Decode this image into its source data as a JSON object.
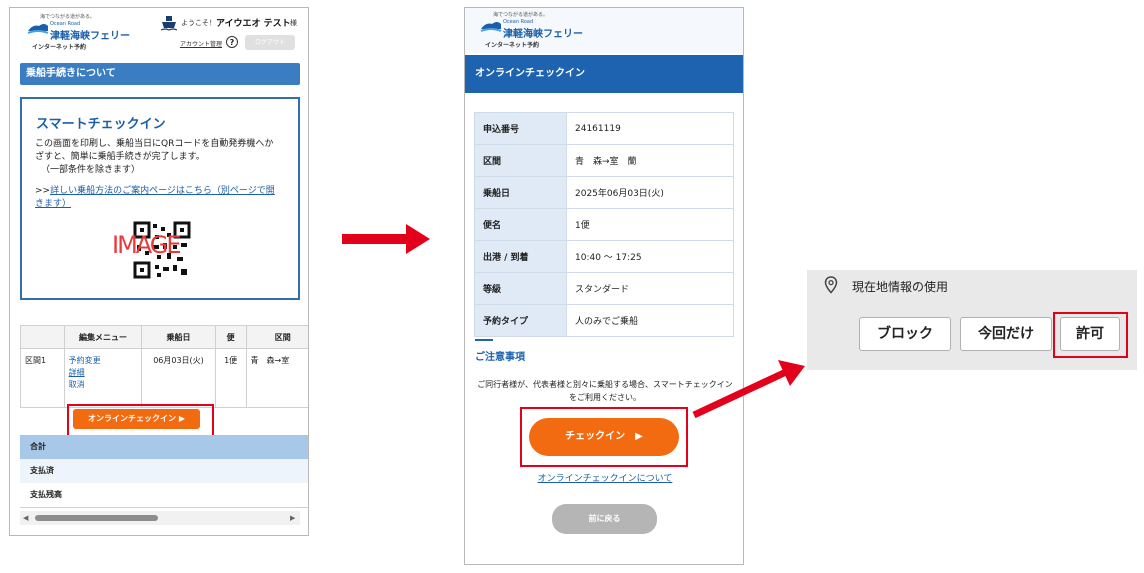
{
  "panel1": {
    "logo": {
      "tagline": "海でつながる道がある。",
      "brand_small": "Ocean Road",
      "brand": "津軽海峡フェリー",
      "sub": "インターネット予約"
    },
    "header": {
      "welcome": "ようこそ！",
      "username": "アイウエオ テスト",
      "honorific": "様",
      "account": "アカウント管理",
      "help": "?",
      "logout": "ログアウト"
    },
    "section_title": "乗船手続きについて",
    "smart": {
      "title": "スマートチェックイン",
      "desc1": "この画面を印刷し、乗船当日にQRコードを自動発券機へか",
      "desc2": "ざすと、簡単に乗船手続きが完了します。",
      "desc3": "（一部条件を除きます）",
      "link_prefix": ">>",
      "link1": "詳しい乗船方法のご案内ページはこちら（別ページで開",
      "link2": "きます）",
      "qr_text": "IMAGE"
    },
    "table": {
      "headers": [
        "",
        "編集メニュー",
        "乗船日",
        "便",
        "区間"
      ],
      "row_label": "区間1",
      "menu": [
        "予約変更",
        "詳細",
        "取消"
      ],
      "date": "06月03日(火)",
      "bin": "1便",
      "route": "青　森→室"
    },
    "checkin_button": "オンラインチェックイン ▶",
    "summary": {
      "total": "合計",
      "paid": "支払済",
      "balance": "支払残高"
    }
  },
  "panel2": {
    "logo": {
      "tagline": "海でつながる道がある。",
      "brand_small": "Ocean Road",
      "brand": "津軽海峡フェリー",
      "sub": "インターネット予約"
    },
    "title": "オンラインチェックイン",
    "rows": [
      {
        "label": "申込番号",
        "value": "24161119"
      },
      {
        "label": "区間",
        "value": "青　森→室　蘭"
      },
      {
        "label": "乗船日",
        "value": "2025年06月03日(火)"
      },
      {
        "label": "便名",
        "value": "1便"
      },
      {
        "label": "出港 / 到着",
        "value": "10:40 〜 17:25"
      },
      {
        "label": "等級",
        "value": "スタンダード"
      },
      {
        "label": "予約タイプ",
        "value": "人のみでご乗船"
      }
    ],
    "notice_title": "ご注意事項",
    "notice_text1": "ご同行者様が、代表者様と別々に乗船する場合、スマートチェックイン",
    "notice_text2": "をご利用ください。",
    "checkin_button": "チェックイン　▶",
    "about_link": "オンラインチェックインについて",
    "back_button": "前に戻る"
  },
  "panel3": {
    "title": "現在地情報の使用",
    "block": "ブロック",
    "once": "今回だけ",
    "allow": "許可"
  },
  "colors": {
    "accent_blue": "#1e63b0",
    "orange": "#f26b10",
    "highlight_red": "#e3001b"
  }
}
